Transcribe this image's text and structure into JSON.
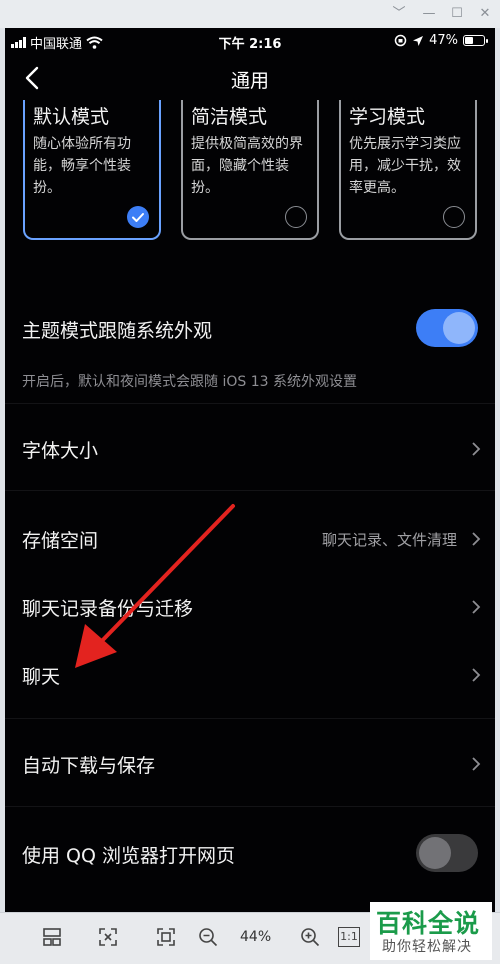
{
  "window": {
    "controls": [
      "﹀",
      "—",
      "☐",
      "✕"
    ]
  },
  "status_bar": {
    "carrier": "中国联通",
    "time": "下午 2:16",
    "battery": "47%",
    "battery_level": 0.47
  },
  "nav": {
    "title": "通用"
  },
  "modes": [
    {
      "name": "默认模式",
      "desc": "随心体验所有功能，畅享个性装扮。",
      "selected": true
    },
    {
      "name": "简洁模式",
      "desc": "提供极简高效的界面，隐藏个性装扮。",
      "selected": false
    },
    {
      "name": "学习模式",
      "desc": "优先展示学习类应用，减少干扰，效率更高。",
      "selected": false
    }
  ],
  "settings": {
    "theme_follow": {
      "label": "主题模式跟随系统外观",
      "on": true
    },
    "theme_note": "开启后，默认和夜间模式会跟随 iOS 13 系统外观设置",
    "font_size": {
      "label": "字体大小"
    },
    "storage": {
      "label": "存储空间",
      "value": "聊天记录、文件清理"
    },
    "backup": {
      "label": "聊天记录备份与迁移"
    },
    "chat": {
      "label": "聊天"
    },
    "auto_download": {
      "label": "自动下载与保存"
    },
    "qq_browser": {
      "label": "使用 QQ 浏览器打开网页",
      "on": false
    }
  },
  "viewer_toolbar": {
    "zoom": "44%",
    "one_to_one": "1:1"
  },
  "watermark": {
    "line1": "百科全说",
    "line2": "助你轻松解决"
  },
  "colors": {
    "accent": "#3d7ef6",
    "arrow": "#e3231f",
    "watermark_green": "#1b9b4a"
  }
}
